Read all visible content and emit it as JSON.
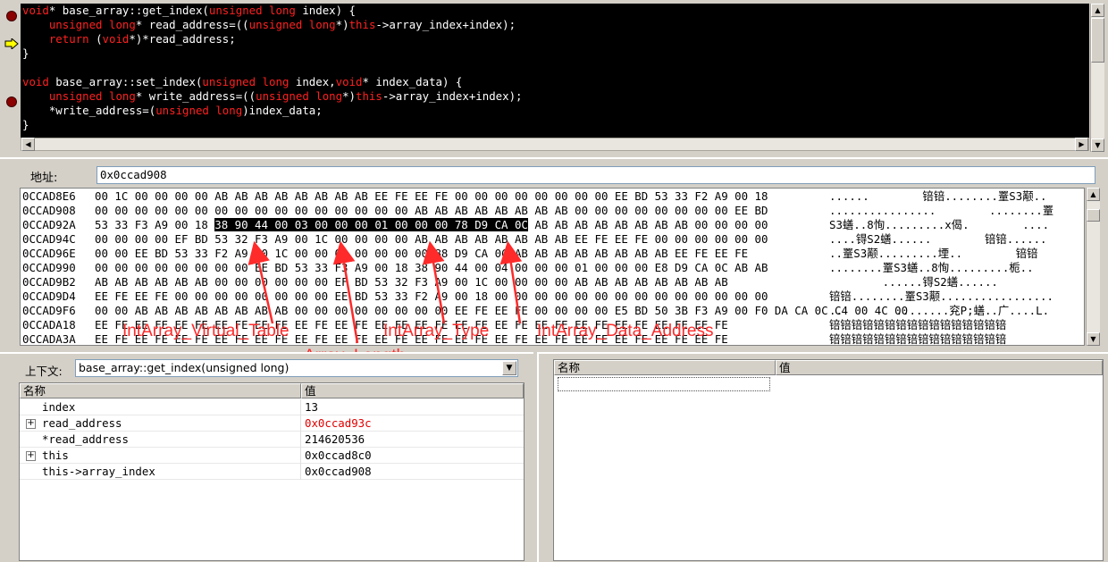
{
  "code": {
    "lines": [
      [
        [
          "void",
          "kw"
        ],
        [
          "* base_array::get_index(",
          ""
        ],
        [
          "unsigned long",
          "kw"
        ],
        [
          " index) {",
          ""
        ]
      ],
      [
        [
          "    ",
          ""
        ],
        [
          "unsigned long",
          "kw"
        ],
        [
          "* read_address=((",
          ""
        ],
        [
          "unsigned long",
          "kw"
        ],
        [
          "*)",
          ""
        ],
        [
          "this",
          "kw"
        ],
        [
          "->array_index+index);",
          ""
        ]
      ],
      [
        [
          "    ",
          ""
        ],
        [
          "return",
          "kw"
        ],
        [
          " (",
          ""
        ],
        [
          "void",
          "kw"
        ],
        [
          "*)*read_address;",
          ""
        ]
      ],
      [
        [
          "}",
          ""
        ]
      ],
      [
        [
          "",
          ""
        ]
      ],
      [
        [
          "void",
          "kw"
        ],
        [
          " base_array::set_index(",
          ""
        ],
        [
          "unsigned long",
          "kw"
        ],
        [
          " index,",
          ""
        ],
        [
          "void",
          "kw"
        ],
        [
          "* index_data) {",
          ""
        ]
      ],
      [
        [
          "    ",
          ""
        ],
        [
          "unsigned long",
          "kw"
        ],
        [
          "* write_address=((",
          ""
        ],
        [
          "unsigned long",
          "kw"
        ],
        [
          "*)",
          ""
        ],
        [
          "this",
          "kw"
        ],
        [
          "->array_index+index);",
          ""
        ]
      ],
      [
        [
          "    *write_address=(",
          ""
        ],
        [
          "unsigned long",
          "kw"
        ],
        [
          ")index_data;",
          ""
        ]
      ],
      [
        [
          "}",
          ""
        ]
      ]
    ],
    "breakpoint_icon": "breakpoint-dot",
    "current_line_icon": "yellow-arrow",
    "keyword_color": "#ff2020"
  },
  "memory": {
    "address_label": "地址:",
    "address_value": "0x0ccad908",
    "rows": [
      {
        "addr": "0CCAD8E6",
        "pre": "00 1C 00 00 00 00 AB AB AB AB AB AB AB AB EE FE EE FE 00 00 00 00 00 00 00 00 EE BD 53 33 F2 A9 00 18",
        "hl": "",
        "post": "",
        "ascii": "......        锫锫........罿S3颟.."
      },
      {
        "addr": "0CCAD908",
        "pre": "00 00 00 00 00 00 00 00 00 00 00 00 00 00 00 00 AB AB AB AB AB AB AB AB 00 00 00 00 00 00 00 00 EE BD",
        "hl": "",
        "post": "",
        "ascii": "................        ........罿"
      },
      {
        "addr": "0CCAD92A",
        "pre": "53 33 F3 A9 00 18 ",
        "hl": "38 90 44 00 03 00 00 00 01 00 00 00 78 D9 CA 0C",
        "post": " AB AB AB AB AB AB AB AB 00 00 00 00",
        "ascii": "S3蟮..8恂.........x偈.        ...."
      },
      {
        "addr": "0CCAD94C",
        "pre": "00 00 00 00 EF BD 53 32 F3 A9 00 1C 00 00 00 00 AB AB AB AB AB AB AB AB EE FE EE FE 00 00 00 00 00 00",
        "hl": "",
        "post": "",
        "ascii": "....锝S2蟮......        锫锫......"
      },
      {
        "addr": "0CCAD96E",
        "pre": "00 00 EE BD 53 33 F2 A9 00 1C 00 00 00 00 00 00 00 88 D9 CA 0C AB AB AB AB AB AB AB AB EE FE EE FE",
        "hl": "",
        "post": "",
        "ascii": "..罿S3颟.........堙..        锫锫"
      },
      {
        "addr": "0CCAD990",
        "pre": "00 00 00 00 00 00 00 00 EE BD 53 33 F3 A9 00 18 38 90 44 00 04 00 00 00 01 00 00 00 E8 D9 CA 0C AB AB",
        "hl": "",
        "post": "",
        "ascii": "........罿S3蟮..8恂.........栀.."
      },
      {
        "addr": "0CCAD9B2",
        "pre": "AB AB AB AB AB AB 00 00 00 00 00 00 EF BD 53 32 F3 A9 00 1C 00 00 00 00 AB AB AB AB AB AB AB AB",
        "hl": "",
        "post": "",
        "ascii": "        ......锝S2蟮......        "
      },
      {
        "addr": "0CCAD9D4",
        "pre": "EE FE EE FE 00 00 00 00 00 00 00 00 EE BD 53 33 F2 A9 00 18 00 00 00 00 00 00 00 00 00 00 00 00 00 00",
        "hl": "",
        "post": "",
        "ascii": "锫锫........罿S3颟................."
      },
      {
        "addr": "0CCAD9F6",
        "pre": "00 00 AB AB AB AB AB AB AB AB 00 00 00 00 00 00 00 00 EE FE EE FE 00 00 00 00 E5 BD 50 3B F3 A9 00 F0 DA CA 0C C4 00 4C 00",
        "hl": "",
        "post": "",
        "ascii": "..        ........兖P;蟮..广....L."
      },
      {
        "addr": "0CCADA18",
        "pre": "EE FE EE FE EE FE EE FE EE FE EE FE EE FE EE FE EE FE EE FE EE FE EE FE EE FE EE FE EE FE EE FE",
        "hl": "",
        "post": "",
        "ascii": "锫锫锫锫锫锫锫锫锫锫锫锫锫锫锫锫"
      },
      {
        "addr": "0CCADA3A",
        "pre": "EE FE EE FE EE FE EE FE EE FE EE FE EE FE EE FE EE FE EE FE EE FE EE FE EE FE EE FE EE FE EE FE",
        "hl": "",
        "post": "",
        "ascii": "锫锫锫锫锫锫锫锫锫锫锫锫锫锫锫锫"
      }
    ]
  },
  "annotations": {
    "color": "#ff2a2a",
    "vtable": "IntArray_Virtual_Table",
    "length": "Array_Length",
    "type": "IntArray_Type",
    "data_addr": "IntArray_Data_Address"
  },
  "locals": {
    "context_label": "上下文:",
    "context_value": "base_array::get_index(unsigned long)",
    "col_name": "名称",
    "col_value": "值",
    "rows": [
      {
        "name": "index",
        "value": "13",
        "expandable": false,
        "changed": false
      },
      {
        "name": "read_address",
        "value": "0x0ccad93c",
        "expandable": true,
        "changed": true
      },
      {
        "name": "*read_address",
        "value": "214620536",
        "expandable": false,
        "changed": false
      },
      {
        "name": "this",
        "value": "0x0ccad8c0",
        "expandable": true,
        "changed": false
      },
      {
        "name": "this->array_index",
        "value": "0x0ccad908",
        "expandable": false,
        "changed": false
      }
    ]
  },
  "watch": {
    "col_name": "名称",
    "col_value": "值"
  }
}
